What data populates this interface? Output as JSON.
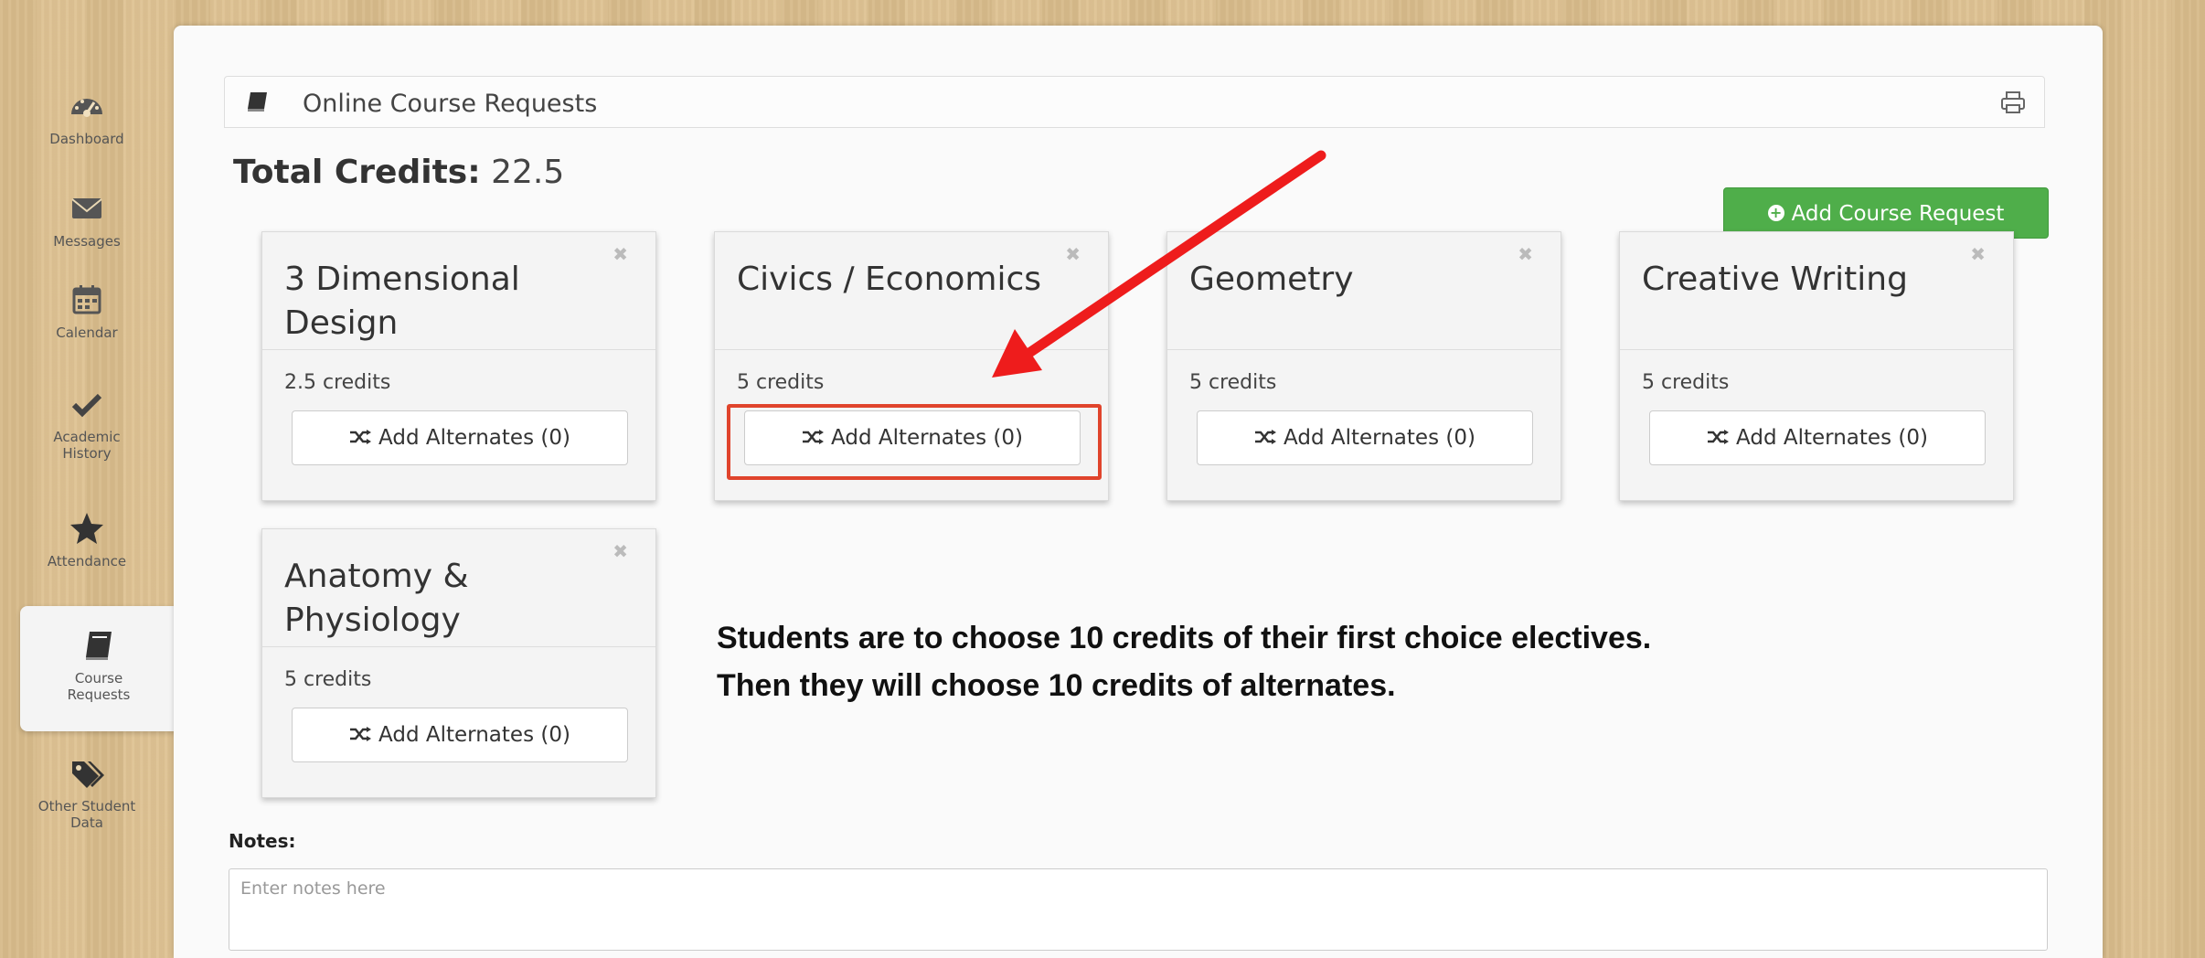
{
  "sidebar": {
    "items": [
      {
        "label": "Dashboard",
        "icon": "dashboard-icon"
      },
      {
        "label": "Messages",
        "icon": "envelope-icon"
      },
      {
        "label": "Calendar",
        "icon": "calendar-icon"
      },
      {
        "label": "Academic History",
        "icon": "checkmark-icon"
      },
      {
        "label": "Attendance",
        "icon": "star-icon"
      },
      {
        "label": "Course Requests",
        "icon": "book-icon",
        "active": true
      },
      {
        "label": "Other Student Data",
        "icon": "tags-icon"
      }
    ]
  },
  "panel": {
    "title": "Online Course Requests",
    "total_label": "Total Credits:",
    "total_value": "22.5",
    "add_button": "Add Course Request"
  },
  "courses": [
    {
      "title": "3 Dimensional Design",
      "credits": "2.5 credits",
      "alternates": "Add Alternates (0)"
    },
    {
      "title": "Civics / Economics",
      "credits": "5 credits",
      "alternates": "Add Alternates (0)",
      "highlighted": true
    },
    {
      "title": "Geometry",
      "credits": "5 credits",
      "alternates": "Add Alternates (0)"
    },
    {
      "title": "Creative Writing",
      "credits": "5 credits",
      "alternates": "Add Alternates (0)"
    },
    {
      "title": "Anatomy & Physiology",
      "credits": "5 credits",
      "alternates": "Add Alternates (0)"
    }
  ],
  "annotation": {
    "line1": "Students are to choose 10 credits of their first choice electives.",
    "line2": "Then they will choose 10 credits of alternates."
  },
  "notes": {
    "label": "Notes:",
    "placeholder": "Enter notes here"
  },
  "colors": {
    "accent_green": "#4fae4a",
    "highlight_red": "#e0442c",
    "arrow_red": "#ee1c1c",
    "wood": "#dcc08f"
  }
}
